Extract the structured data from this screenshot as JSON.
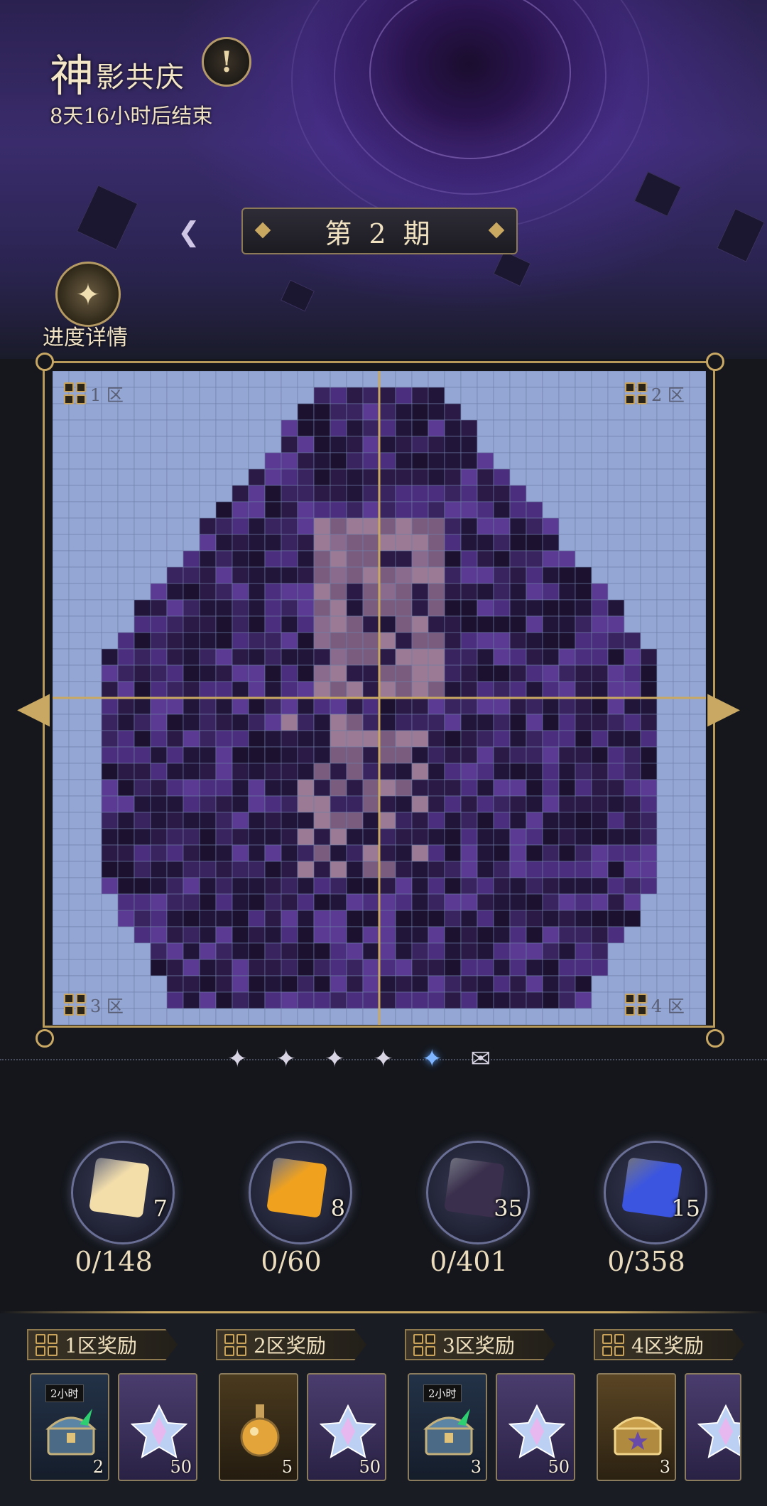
{
  "event": {
    "title_big": "神",
    "title_rest": "影共庆",
    "countdown": "8天16小时后结束",
    "info_icon": "exclamation-icon"
  },
  "period": {
    "label": "第 2 期"
  },
  "progress_detail": {
    "label": "进度详情",
    "icon": "book-star-icon"
  },
  "zones": {
    "z1": "1 区",
    "z2": "2 区",
    "z3": "3 区",
    "z4": "4 区"
  },
  "stars": {
    "count": 5,
    "active_index": 4,
    "mail_icon": "mail-icon"
  },
  "resources": [
    {
      "count": "7",
      "progress": "0/148",
      "color": "#f3deaa"
    },
    {
      "count": "8",
      "progress": "0/60",
      "color": "#f0a21e"
    },
    {
      "count": "35",
      "progress": "0/401",
      "color": "#3a2f4c"
    },
    {
      "count": "15",
      "progress": "0/358",
      "color": "#3b55e0"
    }
  ],
  "rewards": [
    {
      "title": "1区奖励",
      "items": [
        {
          "kind": "chest",
          "tag": "2小时",
          "qty": "2"
        },
        {
          "kind": "crystal",
          "tag": "",
          "qty": "50"
        }
      ]
    },
    {
      "title": "2区奖励",
      "items": [
        {
          "kind": "flask",
          "tag": "",
          "qty": "5"
        },
        {
          "kind": "crystal",
          "tag": "",
          "qty": "50"
        }
      ]
    },
    {
      "title": "3区奖励",
      "items": [
        {
          "kind": "chest",
          "tag": "2小时",
          "qty": "3"
        },
        {
          "kind": "crystal",
          "tag": "",
          "qty": "50"
        }
      ]
    },
    {
      "title": "4区奖励",
      "items": [
        {
          "kind": "gold-chest",
          "tag": "",
          "qty": "3"
        },
        {
          "kind": "crystal",
          "tag": "",
          "qty": ""
        }
      ]
    }
  ],
  "colors": {
    "accent_gold": "#c9a862",
    "grid_empty": "#93a6d4",
    "pixel_dark": "#2a1a45",
    "pixel_purple": "#4b2e7e",
    "pixel_skin": "#8a6b8e"
  }
}
